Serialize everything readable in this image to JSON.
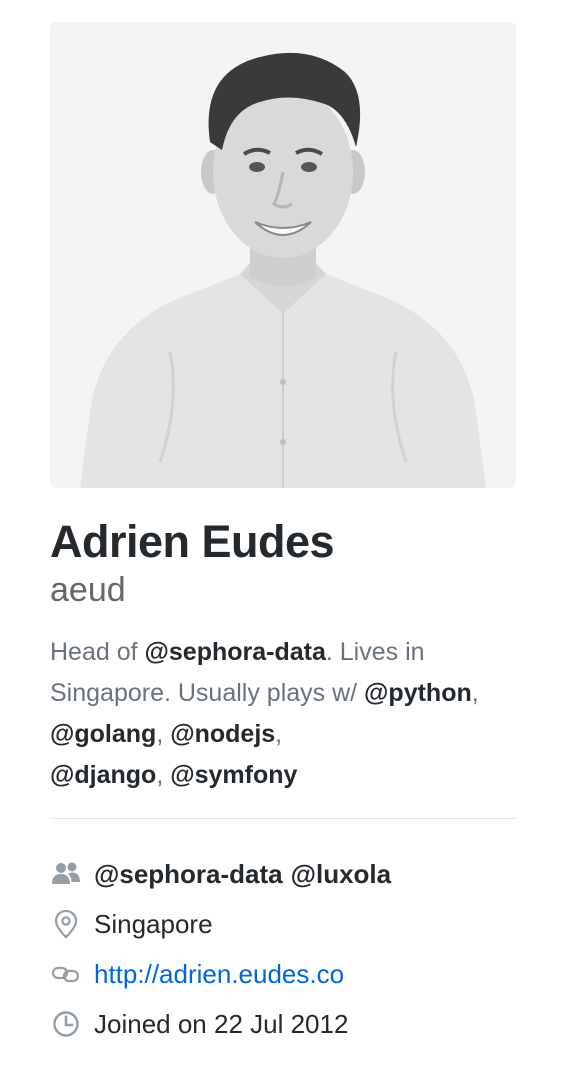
{
  "profile": {
    "avatar_alt": "Adrien Eudes",
    "fullname": "Adrien Eudes",
    "username": "aeud",
    "bio": {
      "part1": "Head of ",
      "mention_company": "@sephora-data",
      "part2": ". Lives in Singapore. Usually plays w/ ",
      "mention_python": "@python",
      "sep1": ", ",
      "mention_golang": "@golang",
      "sep2": ", ",
      "mention_nodejs": "@nodejs",
      "sep3": ",",
      "mention_django": "@django",
      "sep4": ", ",
      "mention_symfony": "@symfony"
    },
    "details": {
      "organizations": [
        "@sephora-data",
        "@luxola"
      ],
      "location": "Singapore",
      "website": "http://adrien.eudes.co",
      "joined": "Joined on 22 Jul 2012"
    },
    "icons": {
      "organization": "organization-icon",
      "location": "location-pin-icon",
      "link": "link-icon",
      "clock": "clock-icon"
    },
    "colors": {
      "text": "#24292e",
      "muted": "#6a737d",
      "link": "#0366d6",
      "divider": "#e1e4e8",
      "icon": "#959da5"
    }
  }
}
